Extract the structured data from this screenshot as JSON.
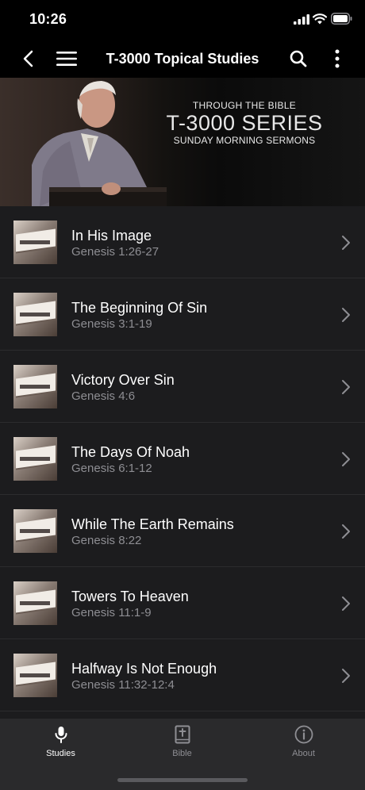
{
  "status_bar": {
    "time": "10:26"
  },
  "header": {
    "title": "T-3000 Topical Studies"
  },
  "banner": {
    "line1": "THROUGH THE BIBLE",
    "line2": "T-3000 SERIES",
    "line3": "SUNDAY MORNING SERMONS"
  },
  "studies": [
    {
      "title": "In His Image",
      "reference": "Genesis 1:26-27"
    },
    {
      "title": "The Beginning Of Sin",
      "reference": "Genesis 3:1-19"
    },
    {
      "title": "Victory Over Sin",
      "reference": "Genesis 4:6"
    },
    {
      "title": "The Days Of Noah",
      "reference": "Genesis 6:1-12"
    },
    {
      "title": "While The Earth Remains",
      "reference": "Genesis 8:22"
    },
    {
      "title": "Towers To Heaven",
      "reference": "Genesis 11:1-9"
    },
    {
      "title": "Halfway Is Not Enough",
      "reference": "Genesis 11:32-12:4"
    }
  ],
  "tabs": [
    {
      "label": "Studies",
      "icon": "microphone-icon",
      "active": true
    },
    {
      "label": "Bible",
      "icon": "bible-icon",
      "active": false
    },
    {
      "label": "About",
      "icon": "info-icon",
      "active": false
    }
  ],
  "colors": {
    "background": "#1c1c1e",
    "secondary_text": "#8e8e93",
    "tab_bar": "#2a2a2c"
  }
}
